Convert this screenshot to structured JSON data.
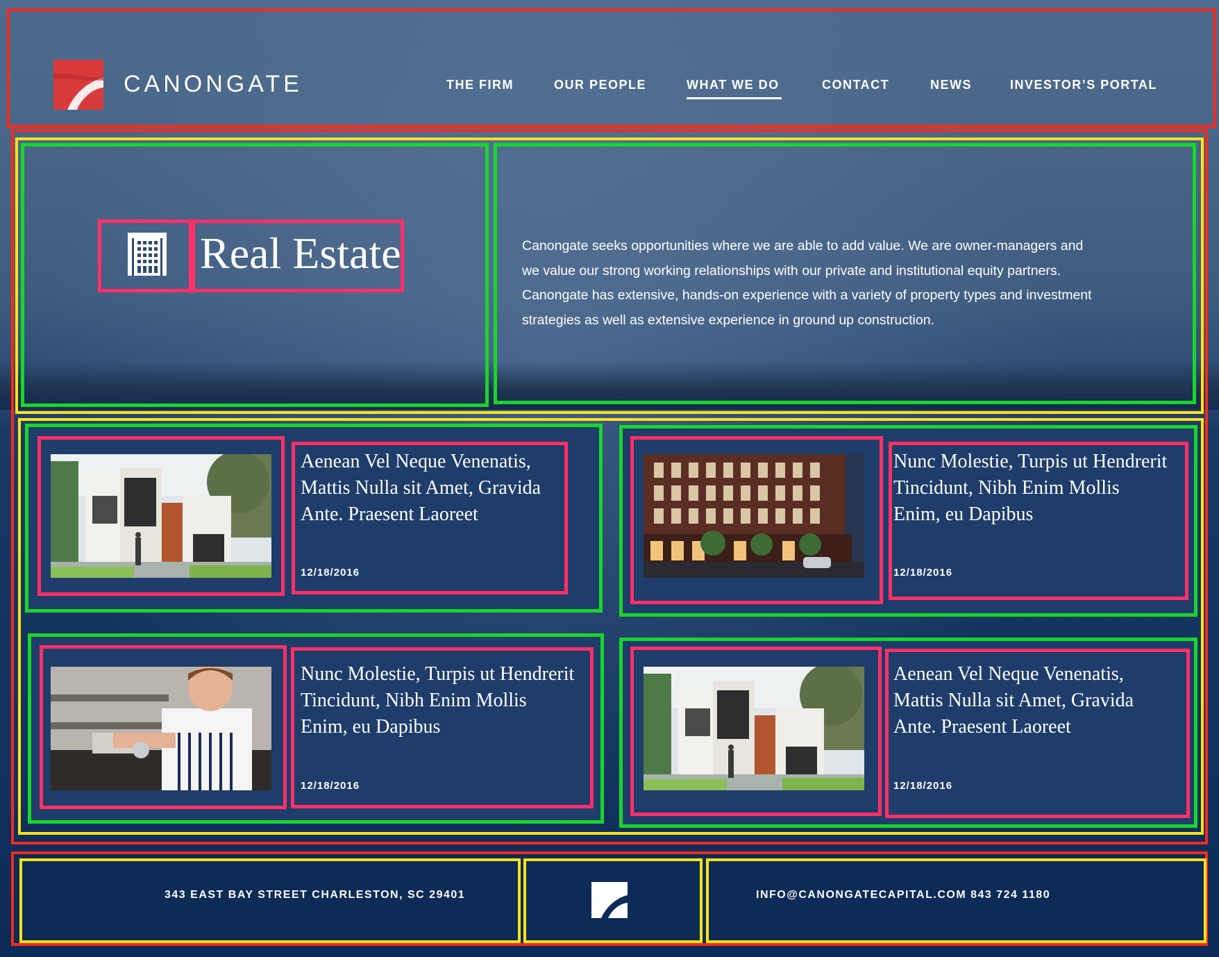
{
  "brand": {
    "name": "CANONGATE",
    "logo_color": "#d8393a"
  },
  "nav": {
    "items": [
      {
        "label": "THE FIRM"
      },
      {
        "label": "OUR PEOPLE"
      },
      {
        "label": "WHAT WE DO",
        "active": true
      },
      {
        "label": "CONTACT"
      },
      {
        "label": "NEWS"
      },
      {
        "label": "INVESTOR’S PORTAL"
      }
    ]
  },
  "hero": {
    "icon": "building-icon",
    "title": "Real Estate",
    "description": "Canongate seeks opportunities where we are able to add value. We are owner-managers and we value our strong working relationships with our private and institutional equity partners. Canongate has extensive, hands-on experience with a variety of property types and investment strategies as well as extensive experience in ground up construction."
  },
  "cards": [
    {
      "title": "Aenean Vel Neque Venenatis, Mattis Nulla sit Amet, Gravida Ante. Praesent Laoreet",
      "date": "12/18/2016",
      "image": "townhouse-rendering"
    },
    {
      "title": "Nunc Molestie, Turpis ut Hendrerit Tincidunt, Nibh Enim Mollis Enim, eu Dapibus",
      "date": "12/18/2016",
      "image": "brick-building-night"
    },
    {
      "title": "Nunc Molestie, Turpis ut Hendrerit Tincidunt, Nibh Enim Mollis Enim, eu Dapibus",
      "date": "12/18/2016",
      "image": "chef-cooking"
    },
    {
      "title": "Aenean Vel Neque Venenatis, Mattis Nulla sit Amet, Gravida Ante. Praesent Laoreet",
      "date": "12/18/2016",
      "image": "townhouse-rendering"
    }
  ],
  "footer": {
    "address": "343 EAST BAY STREET  CHARLESTON, SC 29401",
    "contact": "INFO@CANONGATECAPITAL.COM  843 724 1180"
  },
  "colors": {
    "annotation_red": "#f52a1c",
    "annotation_yellow": "#ffe21a",
    "annotation_green": "#18d62a",
    "annotation_pink": "#ff2f68",
    "navy": "#0c2b56"
  }
}
